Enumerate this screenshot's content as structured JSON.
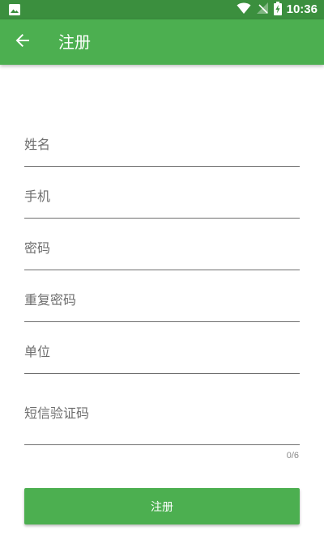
{
  "status_bar": {
    "time": "10:36",
    "icons": [
      "image-notification-icon",
      "wifi-icon",
      "no-signal-icon",
      "battery-charging-icon"
    ]
  },
  "app_bar": {
    "title": "注册",
    "back_icon": "arrow-back-icon"
  },
  "form": {
    "fields": [
      {
        "label": "姓名"
      },
      {
        "label": "手机"
      },
      {
        "label": "密码"
      },
      {
        "label": "重复密码"
      },
      {
        "label": "单位"
      },
      {
        "label": "短信验证码"
      }
    ],
    "sms_counter": "0/6"
  },
  "submit": {
    "label": "注册"
  },
  "colors": {
    "status_bar": "#3b8f3e",
    "app_bar": "#4caf50",
    "button": "#4caf50",
    "label": "#6e6e6e",
    "underline": "#6f6f6f"
  }
}
